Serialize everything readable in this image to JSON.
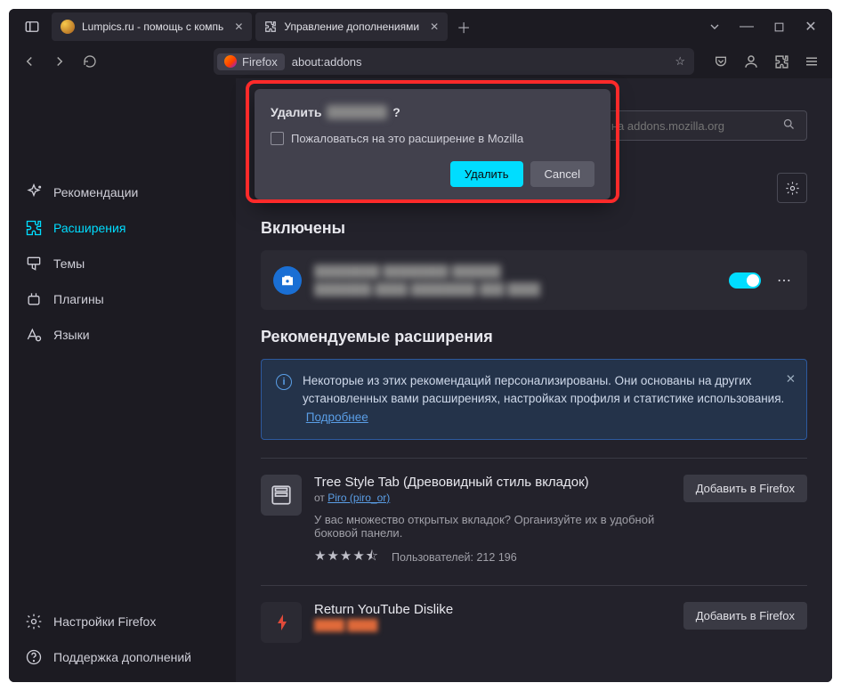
{
  "tabs": [
    {
      "title": "Lumpics.ru - помощь с компь"
    },
    {
      "title": "Управление дополнениями"
    }
  ],
  "url": {
    "brand": "Firefox",
    "addr": "about:addons"
  },
  "sidebar": {
    "recommendations": "Рекомендации",
    "extensions": "Расширения",
    "themes": "Темы",
    "plugins": "Плагины",
    "languages": "Языки",
    "settings": "Настройки Firefox",
    "support": "Поддержка дополнений"
  },
  "search": {
    "placeholder": "Найти больше дополнений на addons.mozilla.org"
  },
  "sections": {
    "enabled": "Включены",
    "recommended": "Рекомендуемые расширения"
  },
  "dialog": {
    "title_prefix": "Удалить",
    "title_suffix": "?",
    "checkbox": "Пожаловаться на это расширение в Mozilla",
    "confirm": "Удалить",
    "cancel": "Cancel"
  },
  "banner": {
    "text": "Некоторые из этих рекомендаций персонализированы. Они основаны на других установленных вами расширениях, настройках профиля и статистике использования.",
    "link": "Подробнее"
  },
  "rec1": {
    "title": "Tree Style Tab (Древовидный стиль вкладок)",
    "by": "от ",
    "author": "Piro (piro_or)",
    "desc": "У вас множество открытых вкладок? Организуйте их в удобной боковой панели.",
    "stars": "★★★★⯪",
    "users_label": "Пользователей: ",
    "users": "212 196",
    "add": "Добавить в Firefox"
  },
  "rec2": {
    "title": "Return YouTube Dislike",
    "add": "Добавить в Firefox"
  }
}
